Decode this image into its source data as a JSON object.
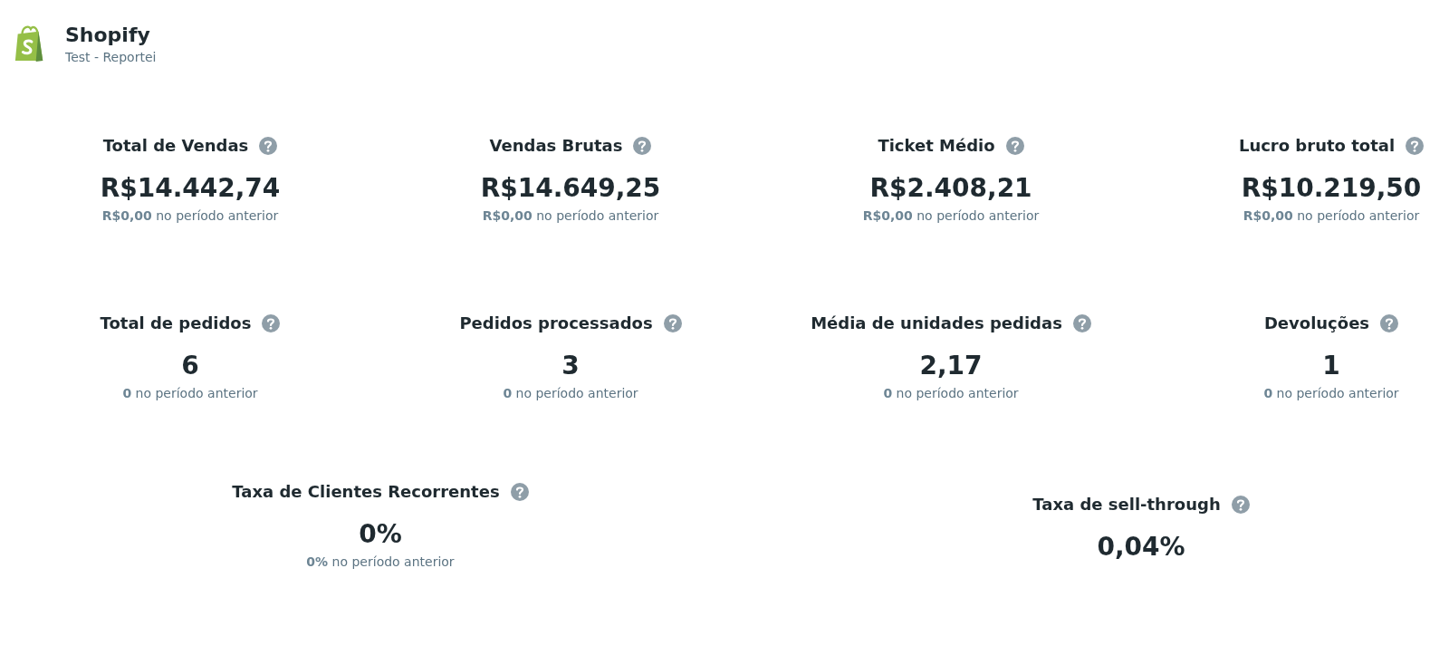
{
  "header": {
    "title": "Shopify",
    "subtitle": "Test - Reportei"
  },
  "metric_rows": [
    {
      "metrics": [
        {
          "label": "Total de Vendas",
          "value": "R$14.442,74",
          "previous": "**R$0,00** no período anterior"
        },
        {
          "label": "Vendas Brutas",
          "value": "R$14.649,25",
          "previous": "**R$0,00** no período anterior"
        },
        {
          "label": "Ticket Médio",
          "value": "R$2.408,21",
          "previous": "**R$0,00** no período anterior"
        },
        {
          "label": "Lucro bruto total",
          "value": "R$10.219,50",
          "previous": "**R$0,00** no período anterior"
        }
      ]
    },
    {
      "metrics": [
        {
          "label": "Total de pedidos",
          "value": "6",
          "previous": "**0** no período anterior"
        },
        {
          "label": "Pedidos processados",
          "value": "3",
          "previous": "**0** no período anterior"
        },
        {
          "label": "Média de unidades pedidas",
          "value": "2,17",
          "previous": "**0** no período anterior"
        },
        {
          "label": "Devoluções",
          "value": "1",
          "previous": "**0** no período anterior"
        }
      ]
    },
    {
      "metrics": [
        {
          "label": "Taxa de Clientes Recorrentes",
          "value": "0%",
          "previous": "**0%** no período anterior"
        },
        {
          "label": "Taxa de sell-through",
          "value": "0,04%"
        }
      ]
    }
  ]
}
